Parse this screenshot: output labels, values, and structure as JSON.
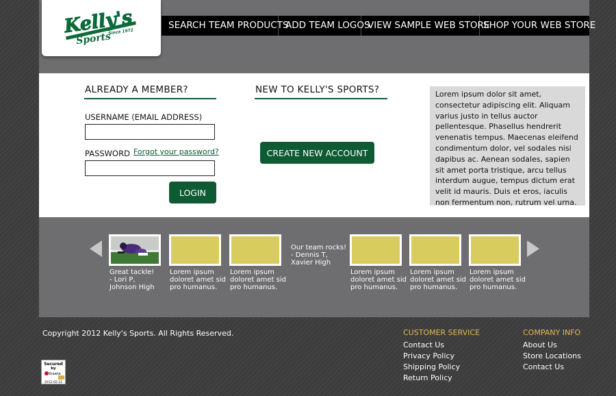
{
  "logo": {
    "brand": "Kelly's",
    "sub": "Sports",
    "since": "Since 1972"
  },
  "nav": [
    "SEARCH TEAM PRODUCTS",
    "ADD TEAM LOGOS",
    "VIEW SAMPLE WEB STORE",
    "SHOP YOUR WEB STORE"
  ],
  "login": {
    "title": "ALREADY A MEMBER?",
    "username_label": "USERNAME (EMAIL ADDRESS)",
    "username_value": "",
    "password_label": "PASSWORD",
    "forgot": "Forgot your password?",
    "login_button": "LOGIN"
  },
  "register": {
    "title": "NEW TO KELLY'S SPORTS?",
    "button": "CREATE NEW ACCOUNT"
  },
  "info_text": "Lorem ipsum dolor sit amet, consectetur adipiscing elit. Aliquam varius justo in tellus auctor pellentesque. Phasellus hendrerit venenatis tempus. Maecenas eleifend condimentum dolor, vel sodales nisi dapibus ac. Aenean sodales, sapien sit amet porta tristique, arcu tellus interdum augue, tempus dictum erat velit id mauris. Duis et eros, iaculis non fermentum non, rutrum vel urna.",
  "carousel": {
    "items": [
      {
        "caption": "Great tackle!\n- Lori P,\nJohnson High",
        "type": "photo"
      },
      {
        "caption": "Lorem ipsum\ndoloret amet sid\npro humanus.",
        "type": "placeholder"
      },
      {
        "caption": "Lorem ipsum\ndoloret amet sid\npro humanus.",
        "type": "placeholder"
      },
      {
        "caption": "Lorem ipsum\ndoloret amet sid\npro humanus.",
        "type": "placeholder"
      },
      {
        "caption": "Lorem ipsum\ndoloret amet sid\npro humanus.",
        "type": "placeholder"
      },
      {
        "caption": "Lorem ipsum\ndoloret amet sid\npro humanus.",
        "type": "placeholder"
      }
    ],
    "quote": "Our team rocks!\n- Dennis T,\nXavier High",
    "placeholder_color": "#d8cc5e"
  },
  "footer": {
    "copyright": "Copyright 2012 Kelly's Sports. All Rights Reserved.",
    "customer_service": {
      "title": "CUSTOMER SERVICE",
      "links": [
        "Contact Us",
        "Privacy Policy",
        "Shipping Policy",
        "Return Policy"
      ]
    },
    "company_info": {
      "title": "COMPANY INFO",
      "links": [
        "About Us",
        "Store Locations",
        "Contact Us"
      ]
    },
    "seal": {
      "line1": "Secured",
      "line2": "by",
      "line3": "thawte",
      "date": "2012-02-22"
    }
  },
  "colors": {
    "brand_green": "#0d5a33",
    "accent_gold": "#e8b84a",
    "band_gray": "#6e6e70"
  }
}
